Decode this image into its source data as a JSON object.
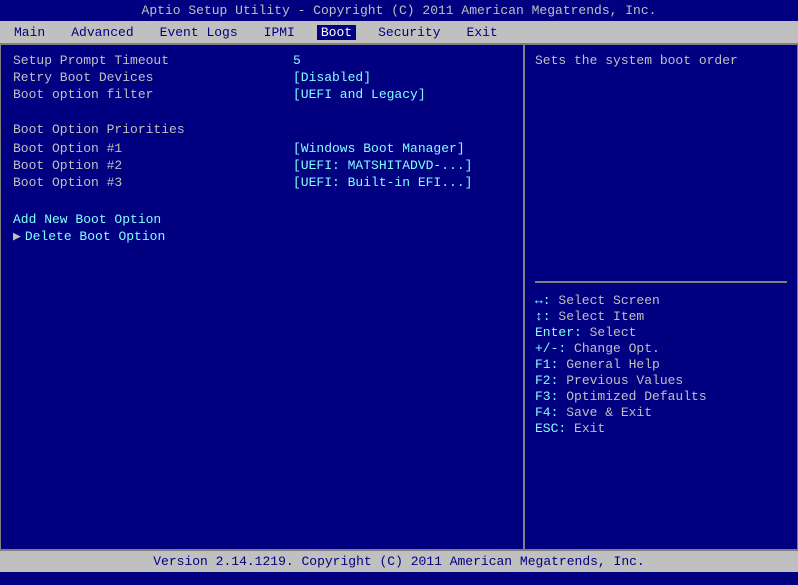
{
  "title": "Aptio Setup Utility - Copyright (C) 2011 American Megatrends, Inc.",
  "nav": {
    "items": [
      {
        "label": "Main",
        "active": false
      },
      {
        "label": "Advanced",
        "active": false
      },
      {
        "label": "Event Logs",
        "active": false
      },
      {
        "label": "IPMI",
        "active": false
      },
      {
        "label": "Boot",
        "active": true
      },
      {
        "label": "Security",
        "active": false
      },
      {
        "label": "Exit",
        "active": false
      }
    ]
  },
  "left": {
    "rows": [
      {
        "type": "row",
        "label": "Setup Prompt Timeout",
        "value": "5"
      },
      {
        "type": "row",
        "label": "Retry Boot Devices",
        "value": "[Disabled]"
      },
      {
        "type": "row",
        "label": "Boot option filter",
        "value": "[UEFI and Legacy]"
      },
      {
        "type": "spacer"
      },
      {
        "type": "header",
        "label": "Boot Option Priorities"
      },
      {
        "type": "row",
        "label": "Boot Option #1",
        "value": "[Windows Boot Manager]"
      },
      {
        "type": "row",
        "label": "Boot Option #2",
        "value": "[UEFI: MATSHITADVD-...]"
      },
      {
        "type": "row",
        "label": "Boot Option #3",
        "value": "[UEFI: Built-in EFI...]"
      },
      {
        "type": "spacer"
      },
      {
        "type": "spacer"
      },
      {
        "type": "link",
        "label": "Add New Boot Option"
      },
      {
        "type": "arrow-link",
        "label": "Delete Boot Option"
      }
    ]
  },
  "right": {
    "description": "Sets the system boot order",
    "help": [
      {
        "key": "↔:",
        "desc": "Select Screen"
      },
      {
        "key": "↕:",
        "desc": "Select Item"
      },
      {
        "key": "Enter:",
        "desc": "Select"
      },
      {
        "key": "+/-:",
        "desc": "Change Opt."
      },
      {
        "key": "F1:",
        "desc": "General Help"
      },
      {
        "key": "F2:",
        "desc": "Previous Values"
      },
      {
        "key": "F3:",
        "desc": "Optimized Defaults"
      },
      {
        "key": "F4:",
        "desc": "Save & Exit"
      },
      {
        "key": "ESC:",
        "desc": "Exit"
      }
    ]
  },
  "footer": "Version 2.14.1219. Copyright (C) 2011 American Megatrends, Inc."
}
